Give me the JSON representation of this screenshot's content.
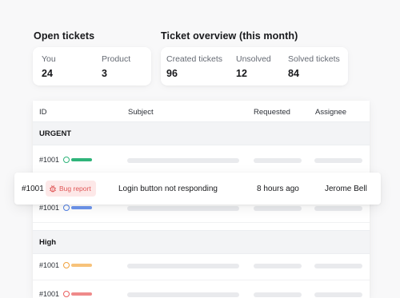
{
  "open_tickets": {
    "title": "Open tickets",
    "stats": [
      {
        "label": "You",
        "value": "24"
      },
      {
        "label": "Product",
        "value": "3"
      }
    ]
  },
  "overview": {
    "title": "Ticket overview (this month)",
    "stats": [
      {
        "label": "Created tickets",
        "value": "96"
      },
      {
        "label": "Unsolved",
        "value": "12"
      },
      {
        "label": "Solved tickets",
        "value": "84"
      }
    ]
  },
  "table": {
    "columns": [
      "ID",
      "Subject",
      "Requested",
      "Assignee"
    ],
    "groups": [
      {
        "label": "URGENT",
        "rows": [
          {
            "id": "#1001",
            "icon": "gift-icon",
            "color": "#2fb47a"
          },
          {
            "id": "#1001",
            "icon": "question-icon",
            "color": "#4f7fe5"
          }
        ]
      },
      {
        "label": "High",
        "rows": [
          {
            "id": "#1001",
            "icon": "clock-icon",
            "color": "#f0a13c"
          },
          {
            "id": "#1001",
            "icon": "bug-icon",
            "color": "#ea5f5f"
          }
        ]
      }
    ]
  },
  "highlighted_ticket": {
    "id": "#1001",
    "tag": "Bug report",
    "tag_icon": "bug-icon",
    "tag_color": "#e05757",
    "tag_bg": "#fde8e8",
    "subject": "Login button not responding",
    "requested": "8 hours ago",
    "assignee": "Jerome Bell"
  }
}
